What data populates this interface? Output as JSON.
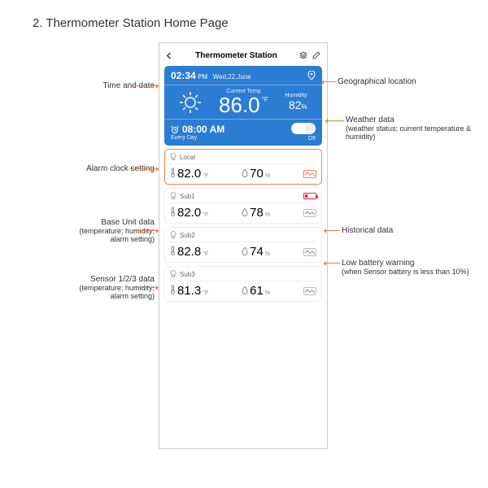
{
  "doc_title": "2. Thermometer Station Home Page",
  "header": {
    "title": "Thermometer Station"
  },
  "datetime": {
    "time": "02:34",
    "ampm": "PM",
    "date": "Wed,22,June"
  },
  "weather": {
    "temp_label": "Current Temp",
    "temp_value": "86.0",
    "temp_unit": "°F",
    "humidity_label": "Humidity",
    "humidity_value": "82",
    "humidity_unit": "%"
  },
  "alarm": {
    "time": "08:00 AM",
    "repeat": "Every Day",
    "state": "Off"
  },
  "cards": [
    {
      "name": "Local",
      "temp": "82.0",
      "temp_unit": "°F",
      "hum": "70",
      "hum_unit": "%",
      "selected": true,
      "low_batt": false
    },
    {
      "name": "Sub1",
      "temp": "82.0",
      "temp_unit": "°F",
      "hum": "78",
      "hum_unit": "%",
      "selected": false,
      "low_batt": true
    },
    {
      "name": "Sub2",
      "temp": "82.8",
      "temp_unit": "°F",
      "hum": "74",
      "hum_unit": "%",
      "selected": false,
      "low_batt": false
    },
    {
      "name": "Sub3",
      "temp": "81.3",
      "temp_unit": "°F",
      "hum": "61",
      "hum_unit": "%",
      "selected": false,
      "low_batt": false
    }
  ],
  "ann": {
    "time_date": "Time and date",
    "geo": "Geographical location",
    "weather": "Weather data",
    "weather_sub": "(weather status; current temperature & humidity)",
    "alarm": "Alarm clock setting",
    "base": "Base Unit data",
    "base_sub": "(temperature; humidity; alarm setting)",
    "hist": "Historical data",
    "sensor": "Sensor 1/2/3 data",
    "sensor_sub": "(temperature; humidity; alarm setting)",
    "batt": "Low battery warning",
    "batt_sub": "(when Sensor battery is less than 10%)"
  }
}
